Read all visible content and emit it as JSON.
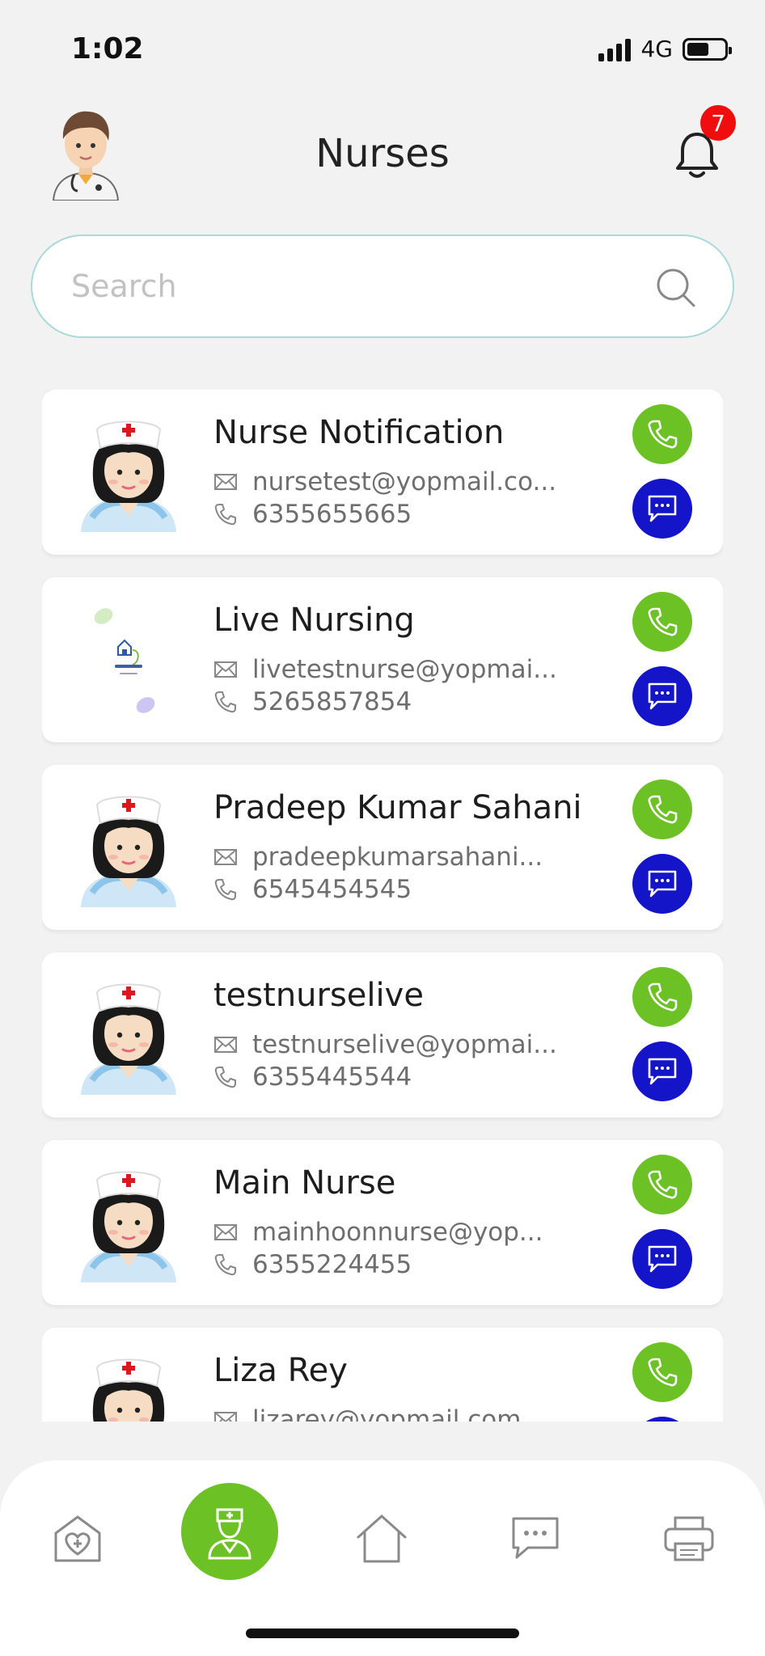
{
  "status": {
    "time": "1:02",
    "network": "4G",
    "battery_level": 0.6
  },
  "header": {
    "title": "Nurses",
    "notification_count": "7"
  },
  "search": {
    "placeholder": "Search",
    "value": ""
  },
  "nurses": [
    {
      "name": "Nurse Notification",
      "email": "nursetest@yopmail.co...",
      "phone": "6355655665",
      "avatar": "nurse-avatar"
    },
    {
      "name": "Live Nursing",
      "email": "livetestnurse@yopmai...",
      "phone": "5265857854",
      "avatar": "logo-image"
    },
    {
      "name": "Pradeep Kumar Sahani",
      "email": "pradeepkumarsahani...",
      "phone": "6545454545",
      "avatar": "nurse-avatar"
    },
    {
      "name": "testnurselive",
      "email": "testnurselive@yopmai...",
      "phone": "6355445544",
      "avatar": "nurse-avatar"
    },
    {
      "name": "Main Nurse",
      "email": "mainhoonnurse@yop...",
      "phone": "6355224455",
      "avatar": "nurse-avatar"
    },
    {
      "name": "Liza Rey",
      "email": "lizarey@yopmail.com",
      "phone": "",
      "avatar": "nurse-avatar"
    }
  ],
  "nav": {
    "items": [
      "hospital-icon",
      "nurse-icon",
      "home-icon",
      "chat-icon",
      "printer-icon"
    ],
    "active": "nurse-icon"
  },
  "colors": {
    "call": "#6cc124",
    "chat": "#1414c8",
    "badge": "#f00d0d",
    "search_border": "#a8dada"
  }
}
